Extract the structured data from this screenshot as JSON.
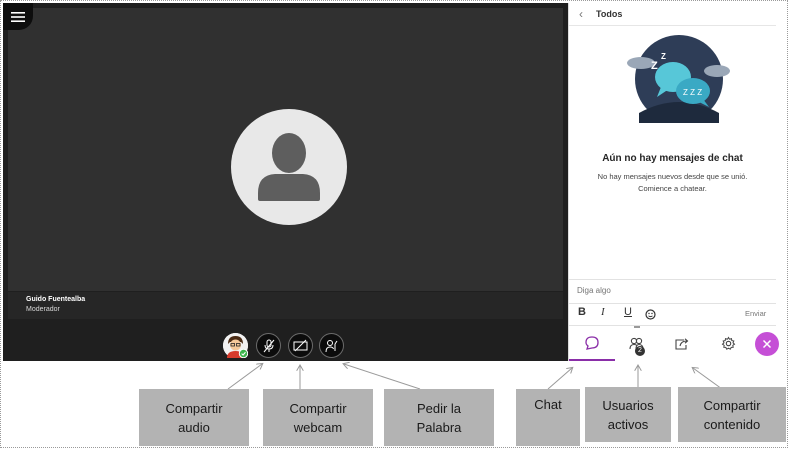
{
  "participant": {
    "name": "Guido Fuentealba",
    "role": "Moderador"
  },
  "chat_panel": {
    "back_label": "‹",
    "title": "Todos",
    "empty_title": "Aún no hay mensajes de chat",
    "empty_text_line1": "No hay mensajes nuevos desde que se unió.",
    "empty_text_line2": "Comience a chatear.",
    "input_placeholder": "Diga algo",
    "format_bold": "B",
    "format_italic": "I",
    "format_underline": "U",
    "send_label": "Enviar",
    "users_count": "2"
  },
  "callouts": {
    "audio": [
      "Compartir",
      "audio"
    ],
    "webcam": [
      "Compartir",
      "webcam"
    ],
    "hand": [
      "Pedir la",
      "Palabra"
    ],
    "chat": [
      "Chat"
    ],
    "users": [
      "Usuarios",
      "activos"
    ],
    "content": [
      "Compartir",
      "contenido"
    ]
  },
  "colors": {
    "accent": "#8a2ea8",
    "close_button": "#c54fd6",
    "callout_bg": "#b3b3b3",
    "status_ok": "#3cb44b"
  }
}
